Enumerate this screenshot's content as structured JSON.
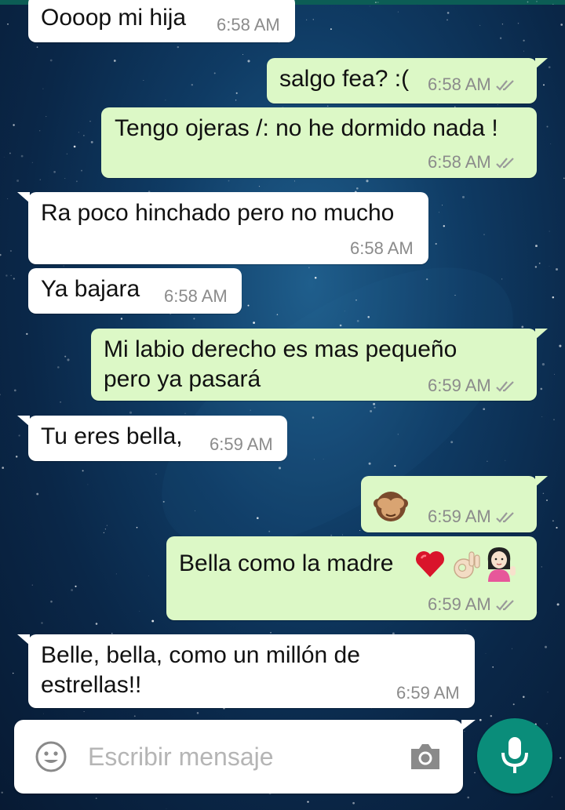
{
  "colors": {
    "incoming_bubble": "#ffffff",
    "outgoing_bubble": "#dcf8c6",
    "read_ticks": "#9a9a9a",
    "mic_button": "#0a8d7a",
    "top_bar": "#0c5d55"
  },
  "messages": [
    {
      "direction": "in",
      "text": "Oooop mi hija",
      "time": "6:58 AM"
    },
    {
      "direction": "out",
      "text": "salgo fea? :(",
      "time": "6:58 AM",
      "status": "double-check-icon"
    },
    {
      "direction": "out",
      "text": "Tengo ojeras /: no he dormido nada !",
      "time": "6:58 AM",
      "status": "double-check-icon"
    },
    {
      "direction": "in",
      "text": "Ra poco hinchado pero no mucho",
      "time": "6:58 AM"
    },
    {
      "direction": "in",
      "text": "Ya bajara",
      "time": "6:58 AM"
    },
    {
      "direction": "out",
      "text": "Mi labio derecho es mas pequeño\npero ya pasará",
      "time": "6:59 AM",
      "status": "double-check-icon"
    },
    {
      "direction": "in",
      "text": "Tu eres bella,",
      "time": "6:59 AM"
    },
    {
      "direction": "out",
      "text": "",
      "emoji": [
        "see-no-evil-monkey-emoji"
      ],
      "time": "6:59 AM",
      "status": "double-check-icon"
    },
    {
      "direction": "out",
      "text": "Bella como la madre",
      "emoji": [
        "red-heart-emoji",
        "ok-hand-emoji",
        "tipping-hand-woman-emoji"
      ],
      "time": "6:59 AM",
      "status": "double-check-icon"
    },
    {
      "direction": "in",
      "text": "Belle, bella, como un millón de\nestrellas!!",
      "time": "6:59 AM"
    }
  ],
  "composer": {
    "placeholder": "Escribir mensaje",
    "value": "",
    "emoji_icon": "smiley-icon",
    "camera_icon": "camera-icon",
    "send_icon": "microphone-icon"
  }
}
